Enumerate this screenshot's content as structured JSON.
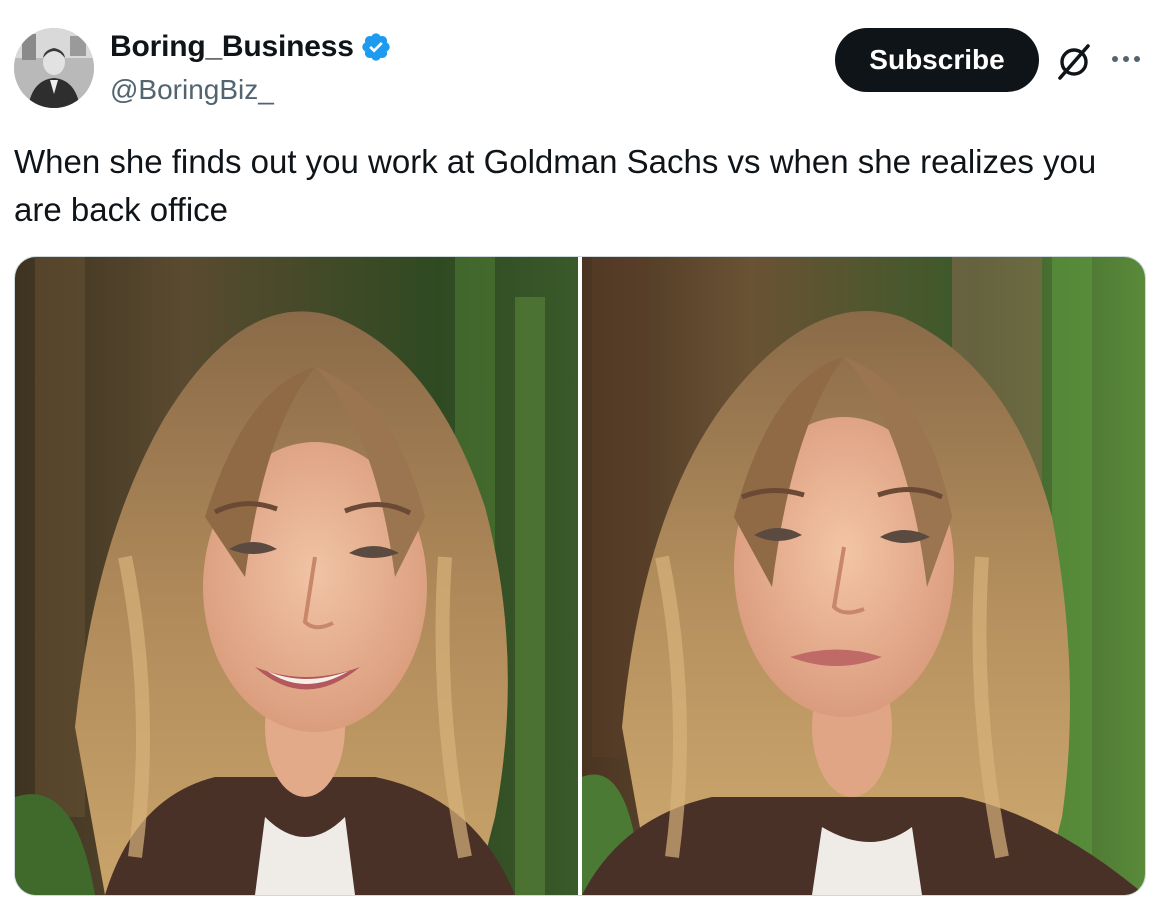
{
  "post": {
    "author": {
      "display_name": "Boring_Business",
      "handle": "@BoringBiz_",
      "verified": true,
      "avatar_icon": "profile-photo"
    },
    "actions": {
      "subscribe_label": "Subscribe",
      "grok_icon": "grok-icon",
      "more_icon": "more-icon"
    },
    "text": "When she finds out you work at Goldman Sachs vs when she realizes you are back office",
    "media": {
      "panels": [
        {
          "expression": "smiling"
        },
        {
          "expression": "neutral"
        }
      ]
    }
  },
  "colors": {
    "verified": "#1d9bf0",
    "subscribe_bg": "#0f1419",
    "secondary_text": "#536471"
  }
}
